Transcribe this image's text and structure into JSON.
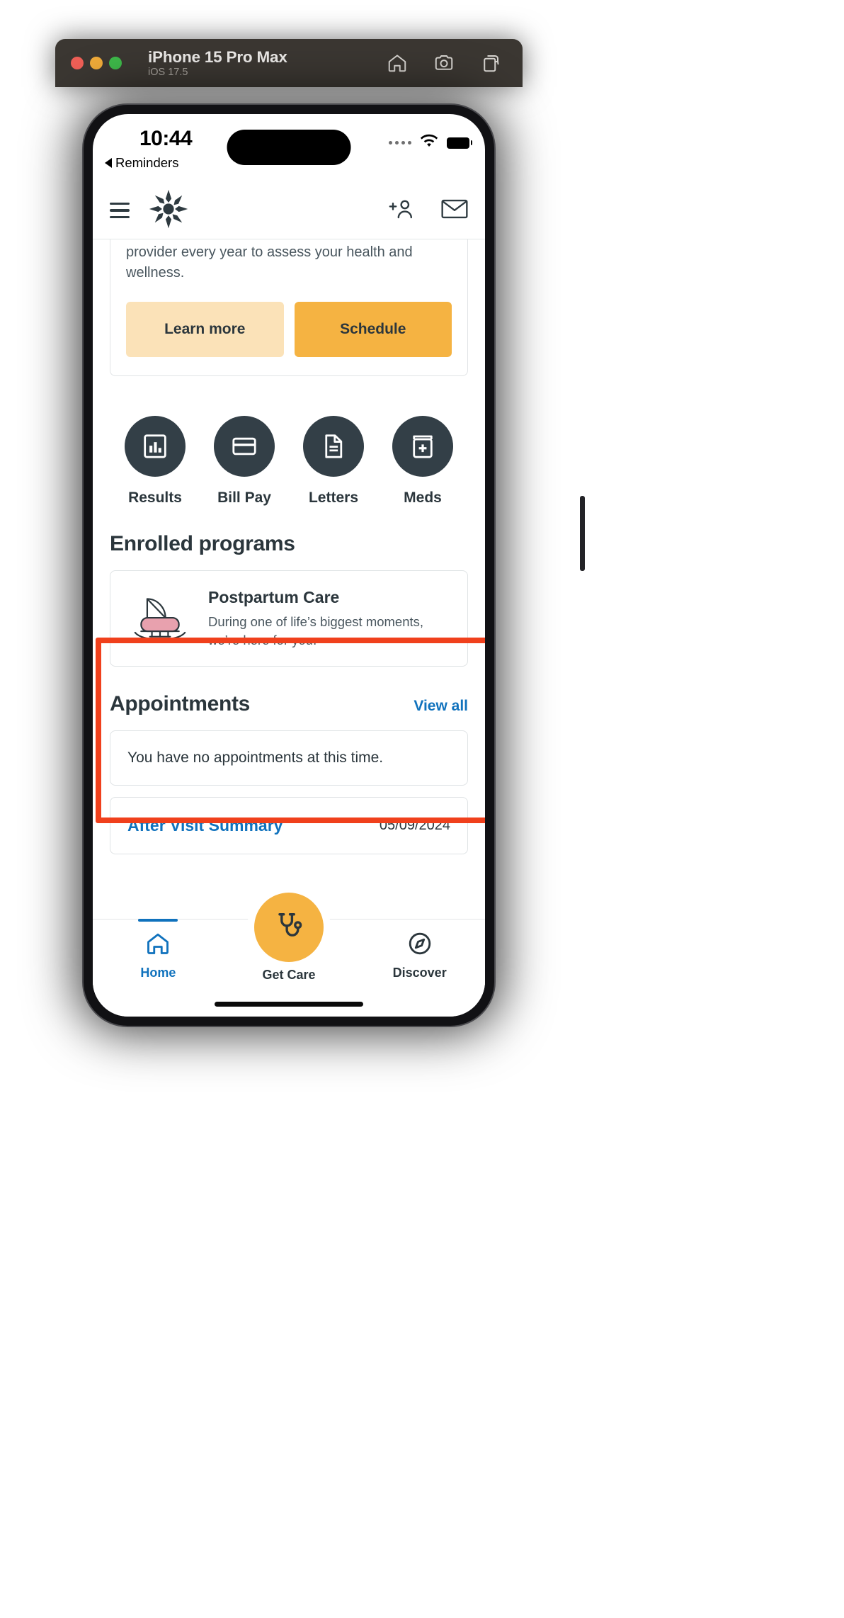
{
  "simulator": {
    "title": "iPhone 15 Pro Max",
    "os": "iOS 17.5",
    "tools": [
      {
        "name": "home-icon",
        "label": "Home"
      },
      {
        "name": "screenshot-icon",
        "label": "Screenshot"
      },
      {
        "name": "rotate-icon",
        "label": "Rotate"
      }
    ]
  },
  "status_bar": {
    "time": "10:44",
    "back_label": "Reminders",
    "cellular": "signal-dots",
    "wifi": "wifi-icon",
    "battery": "battery-full-icon"
  },
  "app_nav": {
    "menu_icon": "hamburger-menu-icon",
    "logo": "health-cross-logo",
    "add_person_icon": "add-person-icon",
    "messages_icon": "envelope-icon"
  },
  "health_maintenance": {
    "body": "provider every year to assess your health and wellness.",
    "learn_more_label": "Learn more",
    "schedule_label": "Schedule"
  },
  "quick_actions": [
    {
      "label": "Results",
      "icon": "chart-results-icon"
    },
    {
      "label": "Bill Pay",
      "icon": "credit-card-icon"
    },
    {
      "label": "Letters",
      "icon": "document-letter-icon"
    },
    {
      "label": "Meds",
      "icon": "pill-bottle-icon"
    }
  ],
  "enrolled_programs": {
    "title": "Enrolled programs",
    "highlighted": true,
    "highlight_color": "#f0401c",
    "items": [
      {
        "title": "Postpartum Care",
        "description": "During one of life’s biggest moments, we’re here for you.",
        "icon": "baby-bassinet-icon"
      }
    ]
  },
  "appointments": {
    "title": "Appointments",
    "view_all_label": "View all",
    "empty_message": "You have no appointments at this time.",
    "items": [
      {
        "title": "After Visit Summary",
        "date": "05/09/2024"
      }
    ]
  },
  "tab_bar": {
    "tabs": [
      {
        "label": "Home",
        "icon": "home-icon",
        "active": true
      },
      {
        "label": "Get Care",
        "icon": "stethoscope-icon",
        "active": false
      },
      {
        "label": "Discover",
        "icon": "compass-icon",
        "active": false
      }
    ]
  },
  "colors": {
    "accent_blue": "#1072bd",
    "accent_yellow": "#f5b342",
    "accent_yellow_light": "#fbe2b8",
    "dark_slate": "#333f47",
    "highlight_red": "#f0401c"
  }
}
